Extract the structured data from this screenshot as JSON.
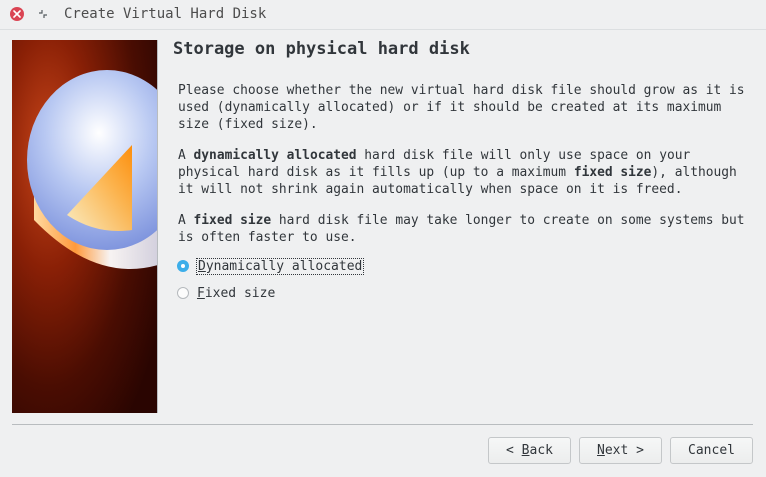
{
  "window": {
    "title": "Create Virtual Hard Disk"
  },
  "titlebar": {
    "close_icon": "close-icon",
    "shade_icon": "shade-icon"
  },
  "page": {
    "title": "Storage on physical hard disk",
    "para1": "Please choose whether the new virtual hard disk file should grow as it is used (dynamically allocated) or if it should be created at its maximum size (fixed size).",
    "para2": {
      "prefix": "A ",
      "bold1": "dynamically allocated",
      "mid": " hard disk file will only use space on your physical hard disk as it fills up (up to a maximum ",
      "bold2": "fixed size",
      "suffix": "), although it will not shrink again automatically when space on it is freed."
    },
    "para3": {
      "prefix": "A ",
      "bold": "fixed size",
      "suffix": " hard disk file may take longer to create on some systems but is often faster to use."
    }
  },
  "options": [
    {
      "mnemonic": "D",
      "rest": "ynamically allocated",
      "checked": true
    },
    {
      "mnemonic": "F",
      "rest": "ixed size",
      "checked": false
    }
  ],
  "buttons": {
    "back_prefix": "< ",
    "back_mnemonic": "B",
    "back_rest": "ack",
    "next_mnemonic": "N",
    "next_rest": "ext >",
    "cancel": "Cancel"
  },
  "colors": {
    "accent": "#3daee9",
    "close": "#da4453",
    "background": "#eff0f1"
  }
}
